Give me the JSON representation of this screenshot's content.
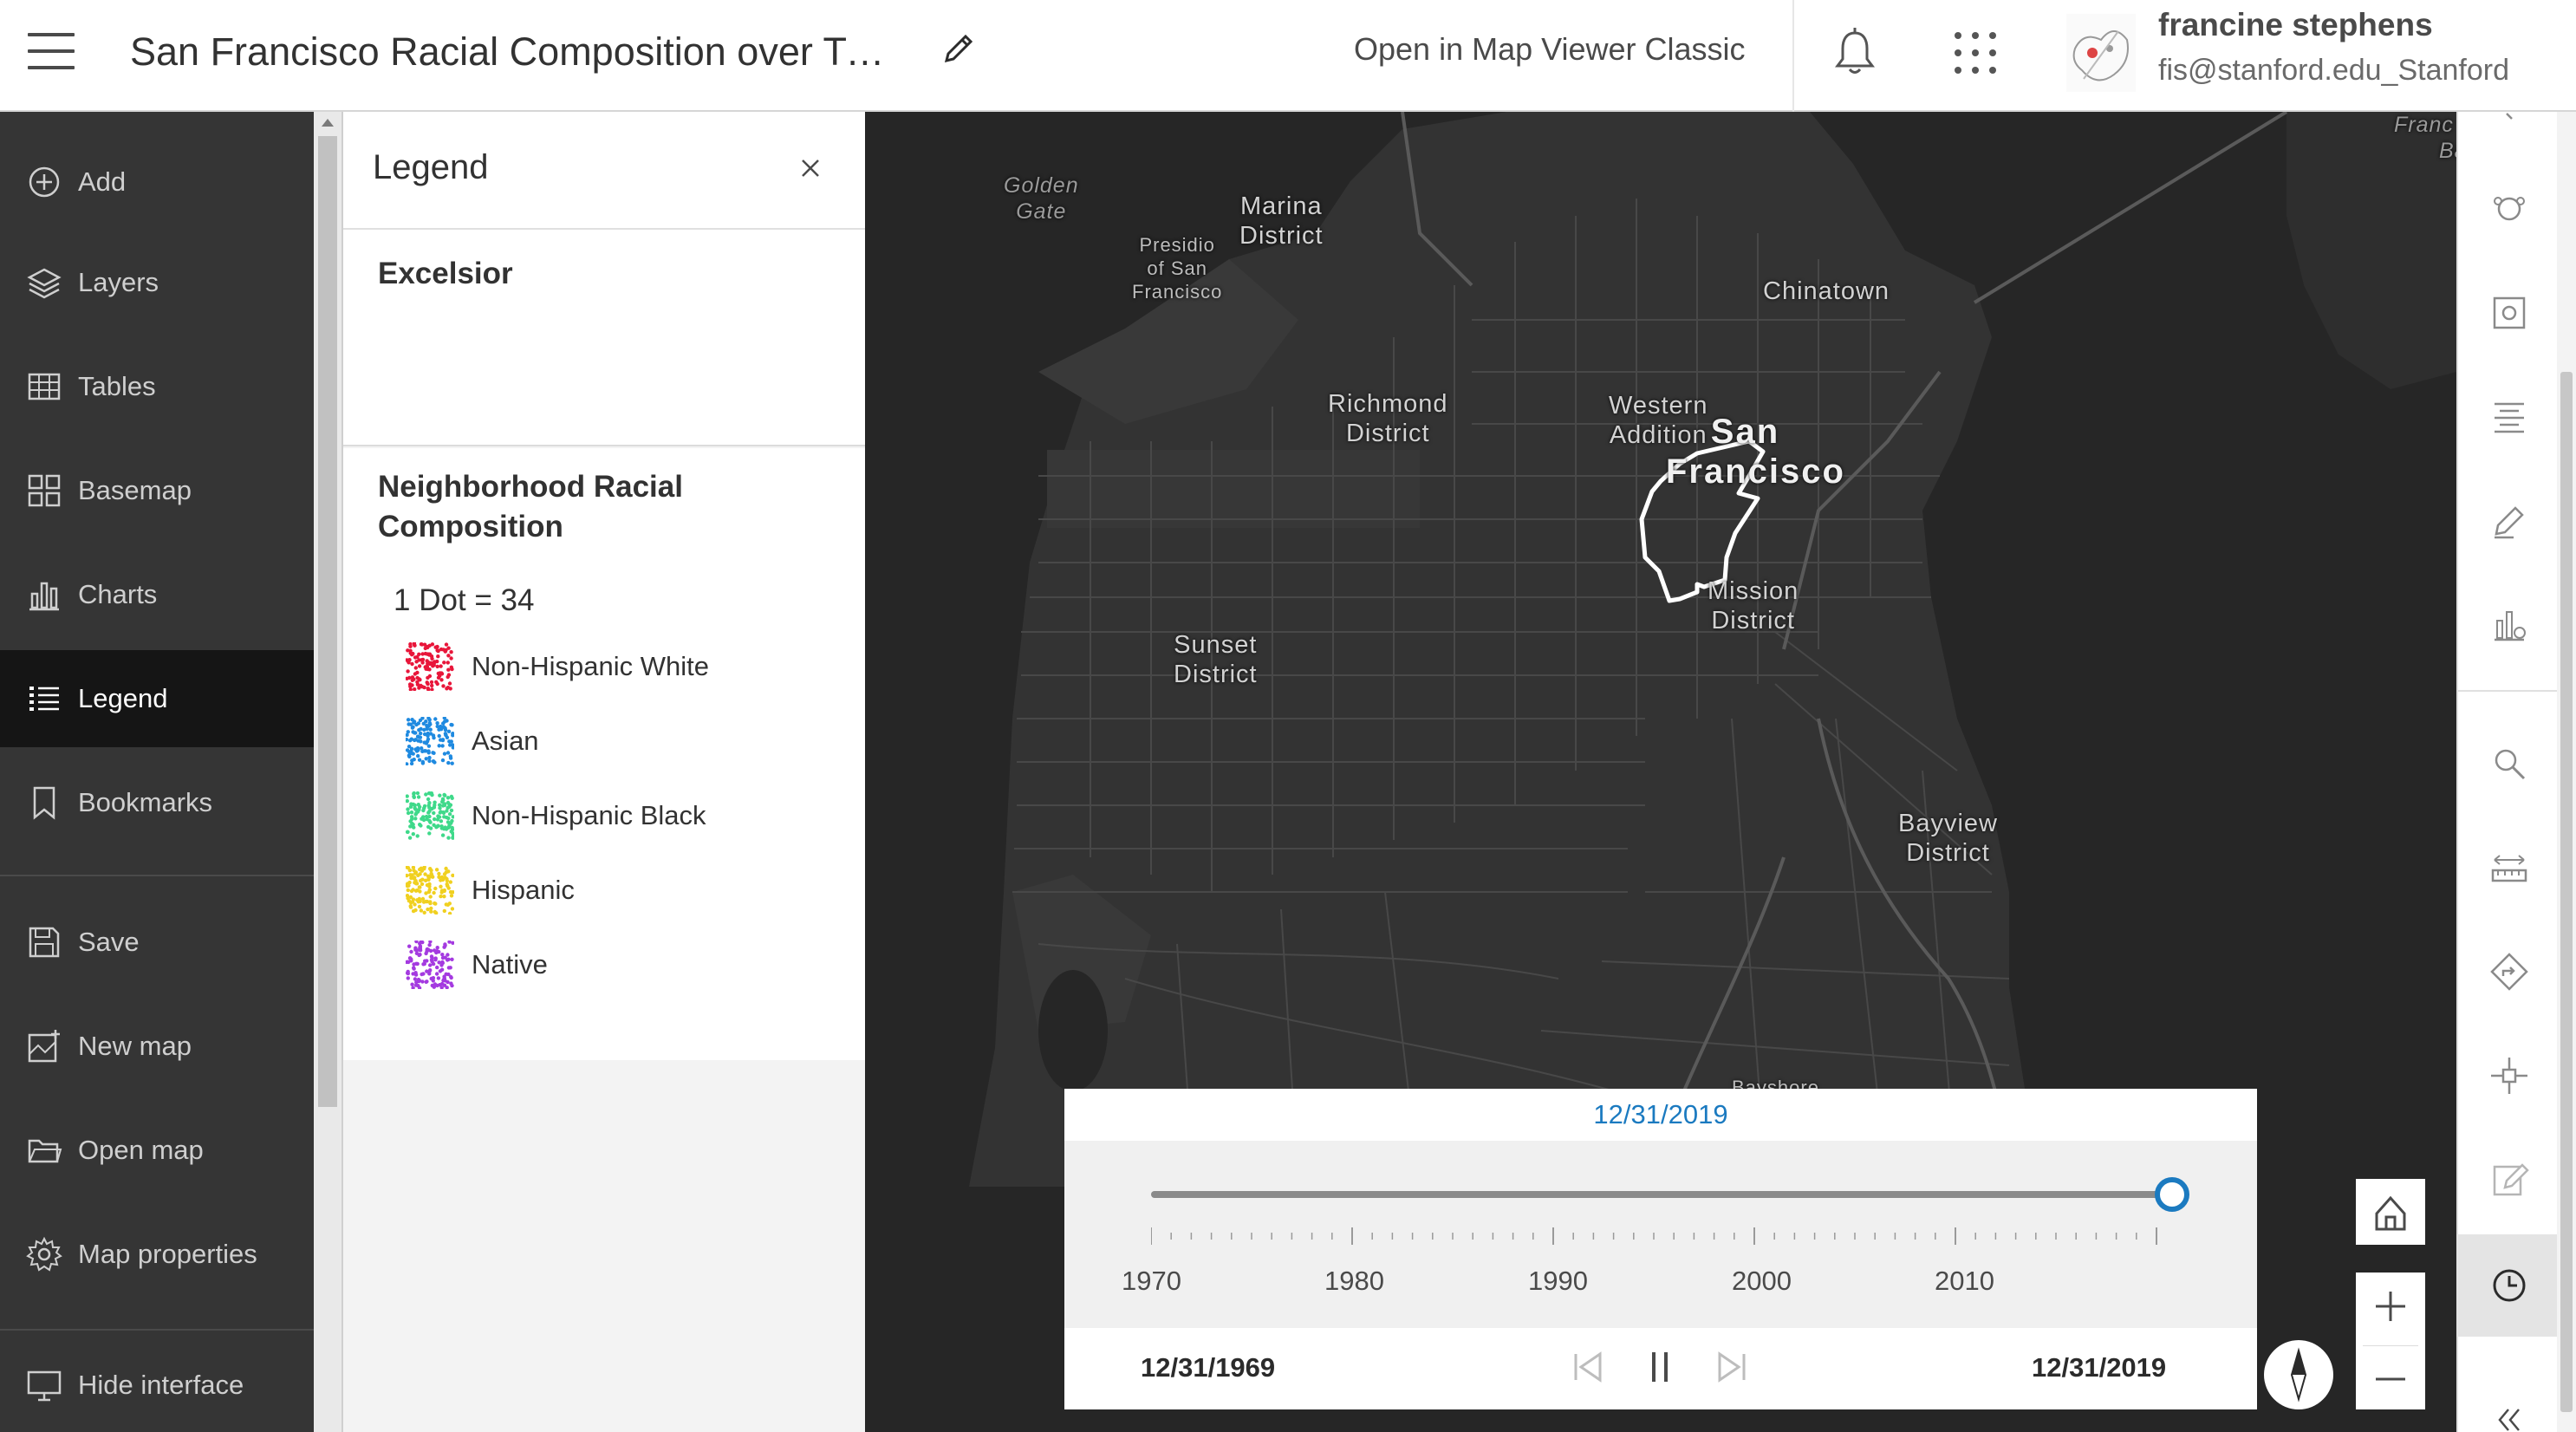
{
  "header": {
    "title": "San Francisco Racial Composition over Ti…",
    "open_classic": "Open in Map Viewer Classic",
    "user_name": "francine stephens",
    "user_email": "fis@stanford.edu_Stanford"
  },
  "nav": {
    "items": [
      {
        "label": "Add",
        "icon": "add-icon"
      },
      {
        "label": "Layers",
        "icon": "layers-icon"
      },
      {
        "label": "Tables",
        "icon": "table-icon"
      },
      {
        "label": "Basemap",
        "icon": "basemap-icon"
      },
      {
        "label": "Charts",
        "icon": "chart-icon"
      },
      {
        "label": "Legend",
        "icon": "legend-icon",
        "active": true
      },
      {
        "label": "Bookmarks",
        "icon": "bookmark-icon"
      },
      {
        "label": "Save",
        "icon": "save-icon"
      },
      {
        "label": "New map",
        "icon": "new-map-icon"
      },
      {
        "label": "Open map",
        "icon": "folder-icon"
      },
      {
        "label": "Map properties",
        "icon": "gear-icon"
      },
      {
        "label": "Hide interface",
        "icon": "monitor-icon"
      }
    ]
  },
  "legend": {
    "title": "Legend",
    "layers": [
      {
        "title": "Excelsior"
      },
      {
        "title": "Neighborhood Racial Composition",
        "dot_value": "1 Dot = 34",
        "items": [
          {
            "label": "Non-Hispanic White",
            "color": "#e8163a"
          },
          {
            "label": "Asian",
            "color": "#1f8ae0"
          },
          {
            "label": "Non-Hispanic Black",
            "color": "#3fd98a"
          },
          {
            "label": "Hispanic",
            "color": "#f0d020"
          },
          {
            "label": "Native",
            "color": "#a43ae0"
          }
        ]
      }
    ]
  },
  "map": {
    "labels": {
      "golden_gate": [
        "Golden",
        "Gate"
      ],
      "marina": [
        "Marina",
        "District"
      ],
      "presidio": [
        "Presidio",
        "of San",
        "Francisco"
      ],
      "chinatown": "Chinatown",
      "richmond": [
        "Richmond",
        "District"
      ],
      "western_addition": [
        "Western",
        "Addition"
      ],
      "san_francisco": [
        "San",
        "Francisco"
      ],
      "mission": [
        "Mission",
        "District"
      ],
      "sunset": [
        "Sunset",
        "District"
      ],
      "bayview": [
        "Bayview",
        "District"
      ],
      "bayshore": "Bayshore",
      "fran_ba": [
        "Franc",
        "Ba"
      ]
    }
  },
  "time_slider": {
    "current_date": "12/31/2019",
    "start_date": "12/31/1969",
    "end_date": "12/31/2019",
    "tick_labels": [
      "1970",
      "1980",
      "1990",
      "2000",
      "2010"
    ],
    "position": 1.0,
    "accent_color": "#1b7ac0"
  },
  "right_toolbar": {
    "icons": [
      "styles-icon",
      "filter-icon",
      "table-list-icon",
      "sketch-icon",
      "chart-config-icon",
      "search-icon",
      "measure-icon",
      "directions-icon",
      "location-icon",
      "edit-icon",
      "clock-icon",
      "collapse-icon"
    ]
  }
}
